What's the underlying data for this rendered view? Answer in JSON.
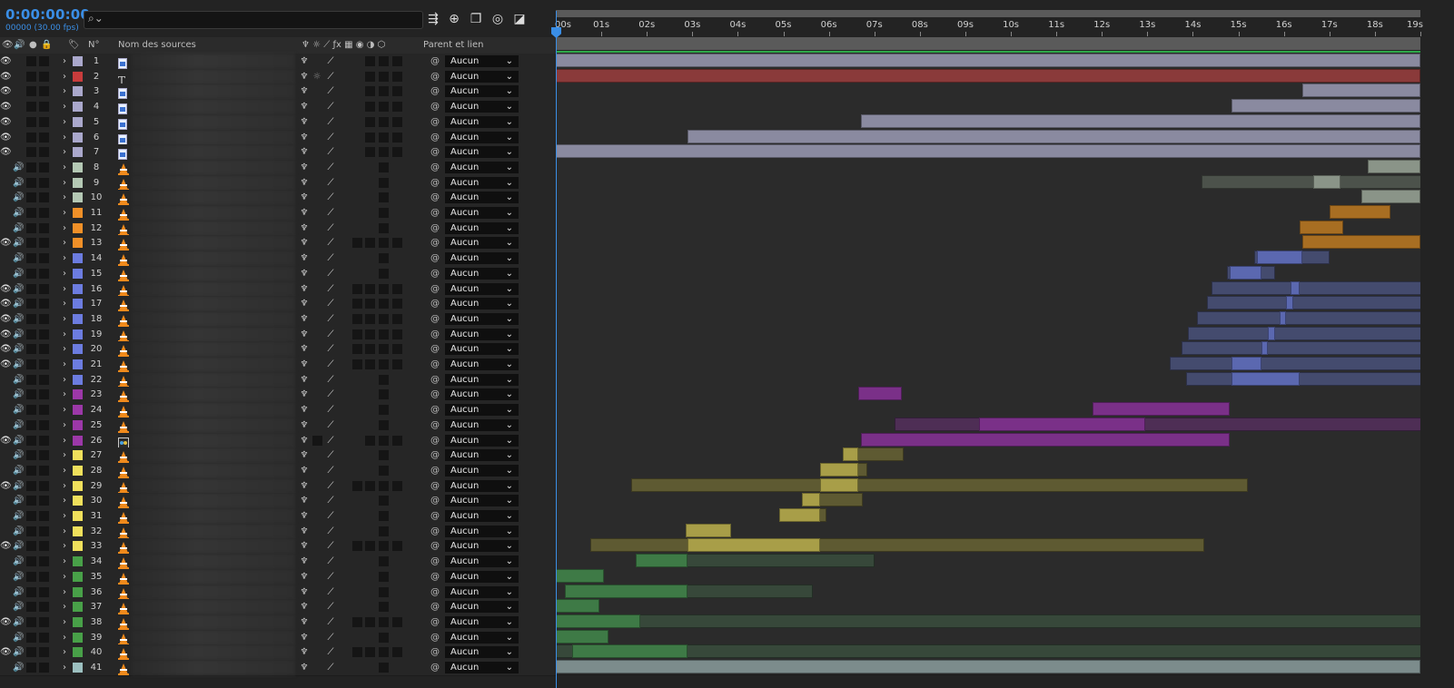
{
  "header": {
    "timecode": "0:00:00:00",
    "frames": "00000 (30.00 fps)",
    "search_placeholder": ""
  },
  "columns": {
    "num": "N°",
    "name": "Nom des sources",
    "parent": "Parent et lien",
    "switch_icons": [
      "puppet-icon",
      "star-icon",
      "slash-icon",
      "fx-icon",
      "frame-blend-icon",
      "motion-blur-icon",
      "adjustment-icon",
      "3d-icon"
    ]
  },
  "ruler": {
    "ticks": [
      "00s",
      "01s",
      "02s",
      "03s",
      "04s",
      "05s",
      "06s",
      "07s",
      "08s",
      "09s",
      "10s",
      "11s",
      "12s",
      "13s",
      "14s",
      "15s",
      "16s",
      "17s",
      "18s",
      "19s"
    ],
    "duration_seconds": 19
  },
  "parent_value": "Aucun",
  "layers": [
    {
      "n": "1",
      "label": "#aaa8cc",
      "type": "image",
      "eye": true,
      "audio": false,
      "bars": [
        [
          0,
          19,
          "#8a8aa0"
        ]
      ]
    },
    {
      "n": "2",
      "label": "#c83c3c",
      "type": "text",
      "eye": true,
      "audio": false,
      "bars": [
        [
          0,
          19,
          "#8a3a3a"
        ]
      ]
    },
    {
      "n": "3",
      "label": "#aaa8cc",
      "type": "image",
      "eye": true,
      "audio": false,
      "bars": [
        [
          16.4,
          19,
          "#8a8aa0"
        ]
      ]
    },
    {
      "n": "4",
      "label": "#aaa8cc",
      "type": "image",
      "eye": true,
      "audio": false,
      "bars": [
        [
          14.85,
          19,
          "#8a8aa0"
        ]
      ]
    },
    {
      "n": "5",
      "label": "#aaa8cc",
      "type": "image",
      "eye": true,
      "audio": false,
      "bars": [
        [
          6.7,
          19,
          "#8a8aa0"
        ]
      ]
    },
    {
      "n": "6",
      "label": "#aaa8cc",
      "type": "image",
      "eye": true,
      "audio": false,
      "bars": [
        [
          2.9,
          19,
          "#8a8aa0"
        ]
      ]
    },
    {
      "n": "7",
      "label": "#aaa8cc",
      "type": "image",
      "eye": true,
      "audio": false,
      "bars": [
        [
          0,
          19,
          "#8a8aa0"
        ]
      ]
    },
    {
      "n": "8",
      "label": "#b4c8b4",
      "type": "vlc",
      "eye": false,
      "audio": true,
      "bars": [
        [
          17.85,
          19,
          "#8a9488"
        ]
      ]
    },
    {
      "n": "9",
      "label": "#b4c8b4",
      "type": "vlc",
      "eye": false,
      "audio": true,
      "bars": [
        [
          14.2,
          19.2,
          "#4c524b"
        ],
        [
          16.65,
          17.25,
          "#8a9488"
        ]
      ]
    },
    {
      "n": "10",
      "label": "#b4c8b4",
      "type": "vlc",
      "eye": false,
      "audio": true,
      "bars": [
        [
          17.7,
          19,
          "#8a9488"
        ]
      ]
    },
    {
      "n": "11",
      "label": "#f09028",
      "type": "vlc",
      "eye": false,
      "audio": true,
      "bars": [
        [
          17,
          18.35,
          "#a86e22"
        ]
      ]
    },
    {
      "n": "12",
      "label": "#f09028",
      "type": "vlc",
      "eye": false,
      "audio": true,
      "bars": [
        [
          16.35,
          17.3,
          "#a86e22"
        ]
      ]
    },
    {
      "n": "13",
      "label": "#f09028",
      "type": "vlc",
      "eye": true,
      "audio": true,
      "bars": [
        [
          16.4,
          19,
          "#a86e22"
        ]
      ]
    },
    {
      "n": "14",
      "label": "#6c7ce0",
      "type": "vlc",
      "eye": false,
      "audio": true,
      "bars": [
        [
          15.35,
          17,
          "#444b6e"
        ],
        [
          15.4,
          16.4,
          "#5b68b0"
        ]
      ]
    },
    {
      "n": "15",
      "label": "#6c7ce0",
      "type": "vlc",
      "eye": false,
      "audio": true,
      "bars": [
        [
          14.75,
          15.8,
          "#444b6e"
        ],
        [
          14.8,
          15.5,
          "#5b68b0"
        ]
      ]
    },
    {
      "n": "16",
      "label": "#6c7ce0",
      "type": "vlc",
      "eye": true,
      "audio": true,
      "bars": [
        [
          14.4,
          19.2,
          "#444b6e"
        ],
        [
          16.15,
          16.35,
          "#5b68b0"
        ]
      ]
    },
    {
      "n": "17",
      "label": "#6c7ce0",
      "type": "vlc",
      "eye": true,
      "audio": true,
      "bars": [
        [
          14.3,
          19.2,
          "#444b6e"
        ],
        [
          16.05,
          16.2,
          "#5b68b0"
        ]
      ]
    },
    {
      "n": "18",
      "label": "#6c7ce0",
      "type": "vlc",
      "eye": true,
      "audio": true,
      "bars": [
        [
          14.1,
          19.2,
          "#444b6e"
        ],
        [
          15.9,
          16.05,
          "#5b68b0"
        ]
      ]
    },
    {
      "n": "19",
      "label": "#6c7ce0",
      "type": "vlc",
      "eye": true,
      "audio": true,
      "bars": [
        [
          13.9,
          19.2,
          "#444b6e"
        ],
        [
          15.65,
          15.8,
          "#5b68b0"
        ]
      ]
    },
    {
      "n": "20",
      "label": "#6c7ce0",
      "type": "vlc",
      "eye": true,
      "audio": true,
      "bars": [
        [
          13.75,
          19.2,
          "#444b6e"
        ],
        [
          15.5,
          15.65,
          "#5b68b0"
        ]
      ]
    },
    {
      "n": "21",
      "label": "#6c7ce0",
      "type": "vlc",
      "eye": true,
      "audio": true,
      "bars": [
        [
          13.5,
          19.2,
          "#444b6e"
        ],
        [
          14.85,
          15.5,
          "#5b68b0"
        ]
      ]
    },
    {
      "n": "22",
      "label": "#6c7ce0",
      "type": "vlc",
      "eye": false,
      "audio": true,
      "bars": [
        [
          13.85,
          19.2,
          "#444b6e"
        ],
        [
          14.85,
          16.35,
          "#5b68b0"
        ]
      ]
    },
    {
      "n": "23",
      "label": "#9c38a8",
      "type": "vlc",
      "eye": false,
      "audio": true,
      "bars": [
        [
          6.65,
          7.6,
          "#7a3088"
        ]
      ]
    },
    {
      "n": "24",
      "label": "#9c38a8",
      "type": "vlc",
      "eye": false,
      "audio": true,
      "bars": [
        [
          11.8,
          14.8,
          "#7a3088"
        ]
      ]
    },
    {
      "n": "25",
      "label": "#9c38a8",
      "type": "vlc",
      "eye": false,
      "audio": true,
      "bars": [
        [
          7.45,
          19.2,
          "#4e2e55"
        ],
        [
          9.3,
          12.95,
          "#7a3088"
        ]
      ]
    },
    {
      "n": "26",
      "label": "#9c38a8",
      "type": "comp",
      "eye": true,
      "audio": true,
      "bars": [
        [
          6.7,
          14.8,
          "#7a3088"
        ]
      ]
    },
    {
      "n": "27",
      "label": "#f0e05c",
      "type": "vlc",
      "eye": false,
      "audio": true,
      "bars": [
        [
          6.3,
          7.65,
          "#5e5a32"
        ],
        [
          6.3,
          6.65,
          "#a89e48"
        ]
      ]
    },
    {
      "n": "28",
      "label": "#f0e05c",
      "type": "vlc",
      "eye": false,
      "audio": true,
      "bars": [
        [
          5.8,
          6.85,
          "#5e5a32"
        ],
        [
          5.8,
          6.65,
          "#a89e48"
        ]
      ]
    },
    {
      "n": "29",
      "label": "#f0e05c",
      "type": "vlc",
      "eye": true,
      "audio": true,
      "bars": [
        [
          1.65,
          15.2,
          "#5e5a32"
        ],
        [
          5.8,
          6.65,
          "#a89e48"
        ]
      ]
    },
    {
      "n": "30",
      "label": "#f0e05c",
      "type": "vlc",
      "eye": false,
      "audio": true,
      "bars": [
        [
          5.4,
          6.75,
          "#5e5a32"
        ],
        [
          5.4,
          5.8,
          "#a89e48"
        ]
      ]
    },
    {
      "n": "31",
      "label": "#f0e05c",
      "type": "vlc",
      "eye": false,
      "audio": true,
      "bars": [
        [
          4.9,
          5.95,
          "#5e5a32"
        ],
        [
          4.9,
          5.8,
          "#a89e48"
        ]
      ]
    },
    {
      "n": "32",
      "label": "#f0e05c",
      "type": "vlc",
      "eye": false,
      "audio": true,
      "bars": [
        [
          2.85,
          3.85,
          "#a89e48"
        ]
      ]
    },
    {
      "n": "33",
      "label": "#f0e05c",
      "type": "vlc",
      "eye": true,
      "audio": true,
      "bars": [
        [
          0.75,
          14.25,
          "#5e5a32"
        ],
        [
          2.9,
          5.8,
          "#a89e48"
        ]
      ]
    },
    {
      "n": "34",
      "label": "#48a048",
      "type": "vlc",
      "eye": false,
      "audio": true,
      "bars": [
        [
          1.75,
          7,
          "#37483a"
        ],
        [
          1.75,
          2.9,
          "#3e7a46"
        ]
      ]
    },
    {
      "n": "35",
      "label": "#48a048",
      "type": "vlc",
      "eye": false,
      "audio": true,
      "bars": [
        [
          0,
          1.05,
          "#3e7a46"
        ]
      ]
    },
    {
      "n": "36",
      "label": "#48a048",
      "type": "vlc",
      "eye": false,
      "audio": true,
      "bars": [
        [
          0.2,
          5.65,
          "#37483a"
        ],
        [
          0.2,
          2.9,
          "#3e7a46"
        ]
      ]
    },
    {
      "n": "37",
      "label": "#48a048",
      "type": "vlc",
      "eye": false,
      "audio": true,
      "bars": [
        [
          0,
          0.95,
          "#3e7a46"
        ]
      ]
    },
    {
      "n": "38",
      "label": "#48a048",
      "type": "vlc",
      "eye": true,
      "audio": true,
      "bars": [
        [
          0,
          19.2,
          "#37483a"
        ],
        [
          0,
          1.85,
          "#3e7a46"
        ]
      ]
    },
    {
      "n": "39",
      "label": "#48a048",
      "type": "vlc",
      "eye": false,
      "audio": true,
      "bars": [
        [
          0,
          1.15,
          "#3e7a46"
        ]
      ]
    },
    {
      "n": "40",
      "label": "#48a048",
      "type": "vlc",
      "eye": true,
      "audio": true,
      "bars": [
        [
          0,
          19.2,
          "#37483a"
        ],
        [
          0.35,
          2.9,
          "#3e7a46"
        ]
      ]
    },
    {
      "n": "41",
      "label": "#9cc0c0",
      "type": "vlc",
      "eye": false,
      "audio": true,
      "bars": [
        [
          0,
          19,
          "#7c8c8c"
        ]
      ]
    }
  ]
}
